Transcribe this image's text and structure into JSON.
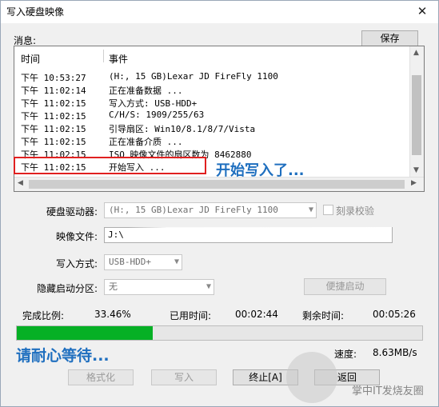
{
  "window": {
    "title": "写入硬盘映像",
    "close_glyph": "✕"
  },
  "messages": {
    "label": "消息:",
    "save_button": "保存",
    "columns": {
      "time": "时间",
      "event": "事件"
    },
    "rows": [
      {
        "time": "下午 10:53:27",
        "event": "(H:, 15 GB)Lexar   JD FireFly      1100"
      },
      {
        "time": "下午 11:02:14",
        "event": "正在准备数据 ..."
      },
      {
        "time": "下午 11:02:15",
        "event": "写入方式: USB-HDD+"
      },
      {
        "time": "下午 11:02:15",
        "event": "C/H/S: 1909/255/63"
      },
      {
        "time": "下午 11:02:15",
        "event": "引导扇区: Win10/8.1/8/7/Vista"
      },
      {
        "time": "下午 11:02:15",
        "event": "正在准备介质 ..."
      },
      {
        "time": "下午 11:02:15",
        "event": "ISO 映像文件的扇区数为 8462880"
      },
      {
        "time": "下午 11:02:15",
        "event": "开始写入 ..."
      }
    ]
  },
  "annotations": {
    "writing_started": "开始写入了...",
    "please_wait": "请耐心等待..."
  },
  "form": {
    "drive_label": "硬盘驱动器:",
    "drive_value": "(H:, 15 GB)Lexar   JD FireFly      1100",
    "verify_label": "刻录校验",
    "image_label": "映像文件:",
    "image_value": "J:\\",
    "write_mode_label": "写入方式:",
    "write_mode_value": "USB-HDD+",
    "hidden_partition_label": "隐藏启动分区:",
    "hidden_partition_value": "无",
    "shortcut_boot_button": "便捷启动"
  },
  "progress": {
    "ratio_label": "完成比例:",
    "ratio_value": "33.46%",
    "ratio_fraction": 0.3346,
    "elapsed_label": "已用时间:",
    "elapsed_value": "00:02:44",
    "remaining_label": "剩余时间:",
    "remaining_value": "00:05:26",
    "speed_label": "速度:",
    "speed_value": "8.63MB/s",
    "bar_color": "#06b025"
  },
  "buttons": {
    "format": "格式化",
    "write": "写入",
    "abort": "终止[A]",
    "return": "返回"
  },
  "watermark": {
    "text": "掌中IT发烧友圈"
  },
  "colors": {
    "annotation": "#1f6fbf",
    "highlight_border": "#e02020"
  }
}
